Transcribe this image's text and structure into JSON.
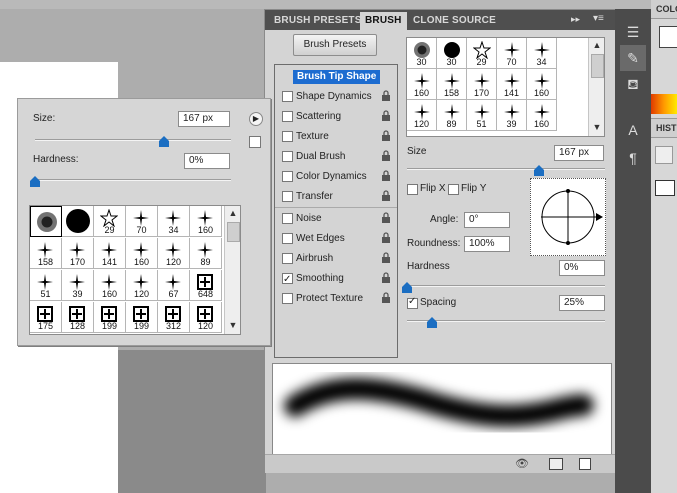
{
  "tabs": {
    "brush_presets": "BRUSH PRESETS",
    "brush": "BRUSH",
    "clone_source": "CLONE SOURCE"
  },
  "panel": {
    "brush_presets_button": "Brush Presets",
    "options": [
      {
        "label": "Brush Tip Shape",
        "selected": true
      },
      {
        "label": "Shape Dynamics",
        "checked": false
      },
      {
        "label": "Scattering",
        "checked": false
      },
      {
        "label": "Texture",
        "checked": false
      },
      {
        "label": "Dual Brush",
        "checked": false
      },
      {
        "label": "Color Dynamics",
        "checked": false
      },
      {
        "label": "Transfer",
        "checked": false
      },
      {
        "label": "Noise",
        "checked": false
      },
      {
        "label": "Wet Edges",
        "checked": false
      },
      {
        "label": "Airbrush",
        "checked": false
      },
      {
        "label": "Smoothing",
        "checked": true
      },
      {
        "label": "Protect Texture",
        "checked": false
      }
    ],
    "tip_grid_numbers": [
      "30",
      "30",
      "29",
      "70",
      "34",
      "160",
      "158",
      "170",
      "141",
      "160",
      "120",
      "89",
      "51",
      "39",
      "160"
    ],
    "size_label": "Size",
    "size_value": "167 px",
    "flip_x": "Flip X",
    "flip_y": "Flip Y",
    "angle_label": "Angle:",
    "angle_value": "0°",
    "roundness_label": "Roundness:",
    "roundness_value": "100%",
    "hardness_label": "Hardness",
    "hardness_value": "0%",
    "spacing_label": "Spacing",
    "spacing_value": "25%",
    "spacing_checked": true
  },
  "picker": {
    "size_label": "Size:",
    "size_value": "167 px",
    "hardness_label": "Hardness:",
    "hardness_value": "0%",
    "grid_numbers": [
      "",
      "",
      "29",
      "70",
      "34",
      "160",
      "158",
      "170",
      "141",
      "160",
      "120",
      "89",
      "51",
      "39",
      "160",
      "120",
      "67",
      "648",
      "175",
      "128",
      "199",
      "199",
      "312",
      "120"
    ]
  },
  "dock": {
    "color_tab": "COLO",
    "history_tab": "HIST"
  },
  "colors": {
    "accent": "#1d6cd0",
    "panel_bg": "#d4d4d4",
    "tab_bar": "#4f4f4f"
  }
}
